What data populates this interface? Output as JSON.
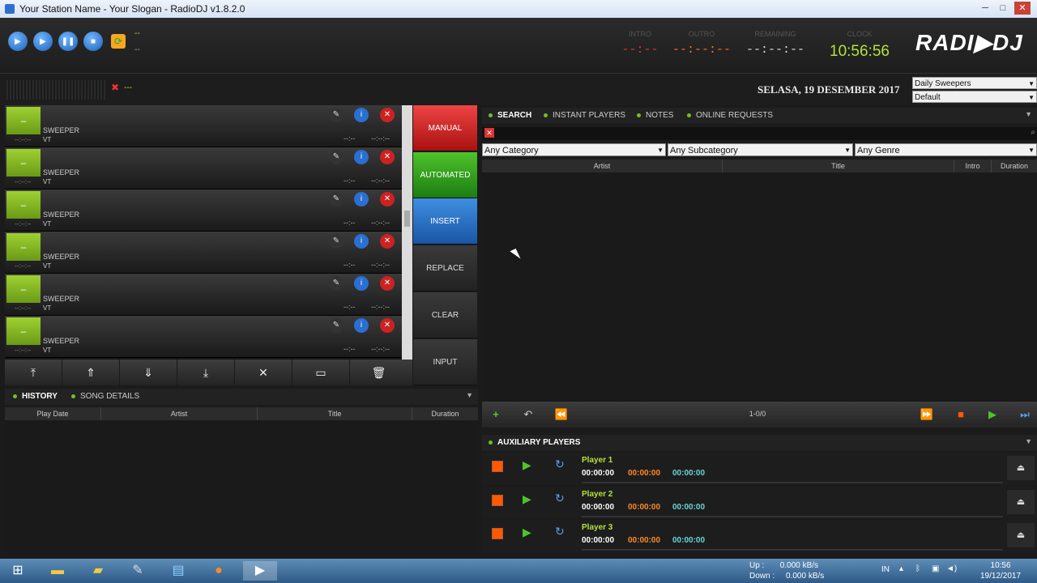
{
  "window": {
    "title": "Your Station Name - Your Slogan - RadioDJ v1.8.2.0",
    "min": "─",
    "max": "□",
    "close": "✕"
  },
  "transport": {
    "play": "▶",
    "play2": "▶",
    "pause": "❚❚",
    "stop": "■",
    "dash1": "--",
    "dash2": "--"
  },
  "timers": {
    "intro_label": "INTRO",
    "intro_value": "--:--",
    "outro_label": "OUTRO",
    "outro_value": "--:--:--",
    "remaining_label": "REMAINING",
    "remaining_value": "--:--:--",
    "clock_label": "CLOCK",
    "clock_value": "10:56:56"
  },
  "logo": "RADI▶DJ",
  "date_text": "SELASA, 19 DESEMBER 2017",
  "selects": {
    "sweepers": "Daily Sweepers",
    "default": "Default"
  },
  "meter_dash": "---",
  "playlist": [
    {
      "thumb": "–",
      "category": "SWEEPER",
      "vt": "VT",
      "time": "--:--:--",
      "dur1": "--:--",
      "dur2": "--:--:--"
    },
    {
      "thumb": "–",
      "category": "SWEEPER",
      "vt": "VT",
      "time": "--:--:--",
      "dur1": "--:--",
      "dur2": "--:--:--"
    },
    {
      "thumb": "–",
      "category": "SWEEPER",
      "vt": "VT",
      "time": "--:--:--",
      "dur1": "--:--",
      "dur2": "--:--:--"
    },
    {
      "thumb": "–",
      "category": "SWEEPER",
      "vt": "VT",
      "time": "--:--:--",
      "dur1": "--:--",
      "dur2": "--:--:--"
    },
    {
      "thumb": "–",
      "category": "SWEEPER",
      "vt": "VT",
      "time": "--:--:--",
      "dur1": "--:--",
      "dur2": "--:--:--"
    },
    {
      "thumb": "–",
      "category": "SWEEPER",
      "vt": "VT",
      "time": "--:--:--",
      "dur1": "--:--",
      "dur2": "--:--:--"
    }
  ],
  "modes": {
    "manual": "MANUAL",
    "automated": "AUTOMATED",
    "insert": "INSERT",
    "replace": "REPLACE",
    "clear": "CLEAR",
    "input": "INPUT"
  },
  "history": {
    "tab_history": "HISTORY",
    "tab_song_details": "SONG DETAILS",
    "columns": [
      "Play Date",
      "Artist",
      "Title",
      "Duration"
    ]
  },
  "search": {
    "tabs": [
      "SEARCH",
      "INSTANT PLAYERS",
      "NOTES",
      "ONLINE REQUESTS"
    ],
    "category": "Any Category",
    "subcategory": "Any Subcategory",
    "genre": "Any Genre",
    "columns": [
      "Artist",
      "Title",
      "Intro",
      "Duration"
    ],
    "pager": "1-0/0"
  },
  "aux": {
    "title": "AUXILIARY PLAYERS",
    "players": [
      {
        "name": "Player 1",
        "t1": "00:00:00",
        "t2": "00:00:00",
        "t3": "00:00:00"
      },
      {
        "name": "Player 2",
        "t1": "00:00:00",
        "t2": "00:00:00",
        "t3": "00:00:00"
      },
      {
        "name": "Player 3",
        "t1": "00:00:00",
        "t2": "00:00:00",
        "t3": "00:00:00"
      }
    ]
  },
  "tray": {
    "up_label": "Up :",
    "up_value": "0.000 kB/s",
    "down_label": "Down :",
    "down_value": "0.000 kB/s",
    "lang": "IN",
    "time": "10:56",
    "date": "19/12/2017"
  }
}
